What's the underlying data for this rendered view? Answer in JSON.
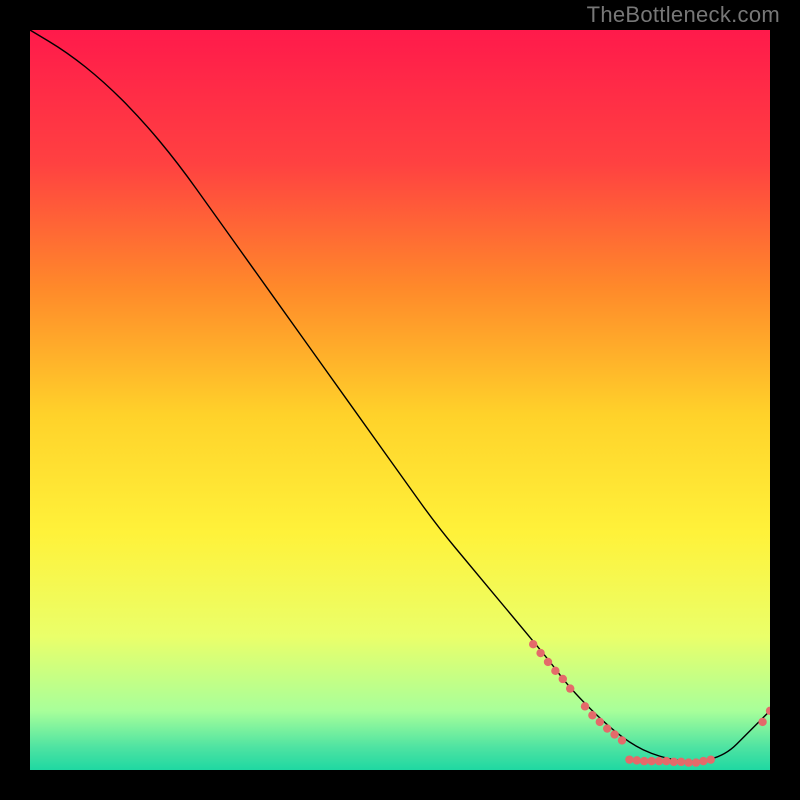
{
  "watermark": "TheBottleneck.com",
  "chart_data": {
    "type": "line",
    "title": "",
    "xlabel": "",
    "ylabel": "",
    "xlim": [
      0,
      100
    ],
    "ylim": [
      0,
      100
    ],
    "grid": false,
    "legend": false,
    "background_gradient": {
      "stops": [
        {
          "offset": 0.0,
          "color": "#ff1a4b"
        },
        {
          "offset": 0.18,
          "color": "#ff4141"
        },
        {
          "offset": 0.35,
          "color": "#ff8a2a"
        },
        {
          "offset": 0.52,
          "color": "#ffd22a"
        },
        {
          "offset": 0.68,
          "color": "#fff23a"
        },
        {
          "offset": 0.82,
          "color": "#eaff6a"
        },
        {
          "offset": 0.92,
          "color": "#a8ff9a"
        },
        {
          "offset": 0.97,
          "color": "#4de3a2"
        },
        {
          "offset": 1.0,
          "color": "#1fd8a2"
        }
      ]
    },
    "series": [
      {
        "name": "curve",
        "stroke": "#000000",
        "stroke_width": 1.4,
        "x": [
          0,
          5,
          10,
          15,
          20,
          25,
          30,
          35,
          40,
          45,
          50,
          55,
          60,
          65,
          70,
          73,
          78,
          82,
          86,
          90,
          94,
          97,
          100
        ],
        "y": [
          100,
          97,
          93,
          88,
          82,
          75,
          68,
          61,
          54,
          47,
          40,
          33,
          27,
          21,
          15,
          11,
          6,
          3,
          1.5,
          1,
          2,
          5,
          8
        ]
      }
    ],
    "scatter": [
      {
        "name": "dots",
        "color": "#e46a6a",
        "radius": 4.2,
        "points": [
          {
            "x": 68,
            "y": 17.0
          },
          {
            "x": 69,
            "y": 15.8
          },
          {
            "x": 70,
            "y": 14.6
          },
          {
            "x": 71,
            "y": 13.4
          },
          {
            "x": 72,
            "y": 12.3
          },
          {
            "x": 73,
            "y": 11.0
          },
          {
            "x": 75,
            "y": 8.6
          },
          {
            "x": 76,
            "y": 7.4
          },
          {
            "x": 77,
            "y": 6.5
          },
          {
            "x": 78,
            "y": 5.6
          },
          {
            "x": 79,
            "y": 4.8
          },
          {
            "x": 80,
            "y": 4.0
          },
          {
            "x": 81,
            "y": 1.4
          },
          {
            "x": 82,
            "y": 1.3
          },
          {
            "x": 83,
            "y": 1.2
          },
          {
            "x": 84,
            "y": 1.2
          },
          {
            "x": 85,
            "y": 1.2
          },
          {
            "x": 86,
            "y": 1.2
          },
          {
            "x": 87,
            "y": 1.1
          },
          {
            "x": 88,
            "y": 1.1
          },
          {
            "x": 89,
            "y": 1.0
          },
          {
            "x": 90,
            "y": 1.0
          },
          {
            "x": 91,
            "y": 1.2
          },
          {
            "x": 92,
            "y": 1.4
          },
          {
            "x": 99,
            "y": 6.5
          },
          {
            "x": 100,
            "y": 8.0
          }
        ]
      }
    ]
  }
}
